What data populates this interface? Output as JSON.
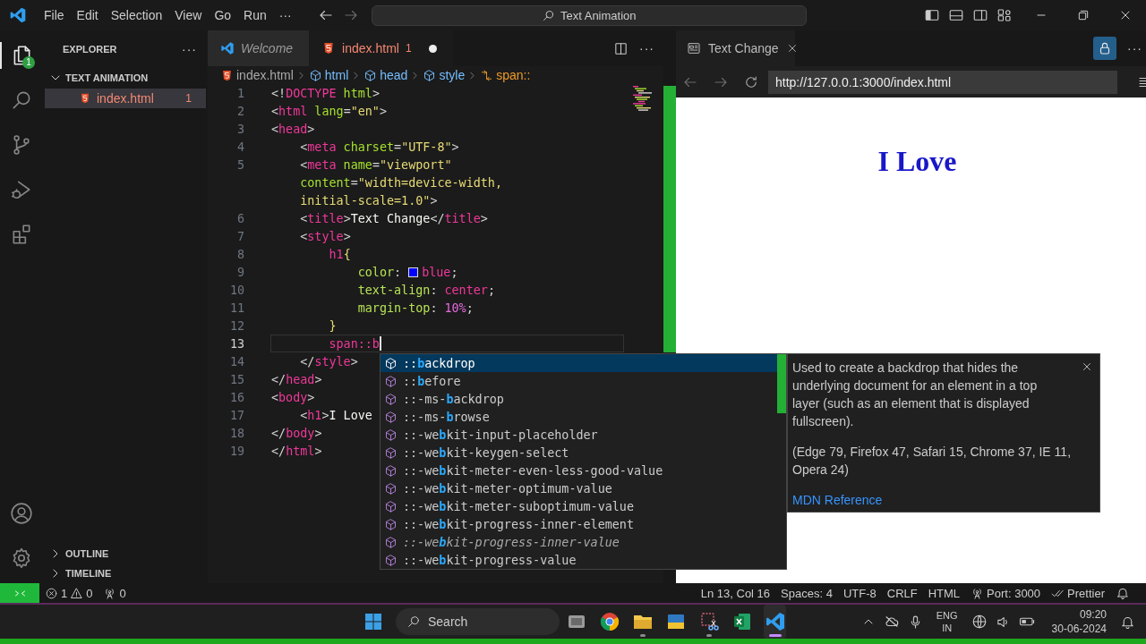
{
  "title_bar": {
    "menu": [
      "File",
      "Edit",
      "Selection",
      "View",
      "Go",
      "Run"
    ],
    "more": "···",
    "command_center": "Text Animation",
    "layout_toggles": [
      {
        "kind": "primary_sidebar",
        "on": true
      },
      {
        "kind": "panel",
        "on": false
      },
      {
        "kind": "secondary_sidebar",
        "on": false
      },
      {
        "kind": "customize",
        "on": false
      }
    ]
  },
  "activity_bar": {
    "items": [
      {
        "kind": "explorer",
        "selected": true,
        "badge": "1"
      },
      {
        "kind": "search",
        "selected": false
      },
      {
        "kind": "source_control",
        "selected": false
      },
      {
        "kind": "run_debug",
        "selected": false
      },
      {
        "kind": "extensions",
        "selected": false
      }
    ],
    "bottom": [
      {
        "kind": "accounts"
      },
      {
        "kind": "manage"
      }
    ]
  },
  "sidebar": {
    "title": "EXPLORER",
    "more": "···",
    "folder": {
      "title": "TEXT ANIMATION",
      "expanded": true,
      "files": [
        {
          "name": "index.html",
          "problems": "1",
          "selected": true
        }
      ]
    },
    "panels": [
      {
        "title": "OUTLINE",
        "expanded": false
      },
      {
        "title": "TIMELINE",
        "expanded": false
      }
    ]
  },
  "editor": {
    "tabs": [
      {
        "kind": "welcome",
        "label": "Welcome",
        "selected": false,
        "modified": false
      },
      {
        "kind": "html",
        "label": "index.html",
        "problems": "1",
        "selected": true,
        "modified": true
      }
    ],
    "more": "···",
    "breadcrumbs": [
      {
        "kind": "file",
        "label": "index.html"
      },
      {
        "kind": "element",
        "label": "html"
      },
      {
        "kind": "element",
        "label": "head"
      },
      {
        "kind": "element",
        "label": "style"
      },
      {
        "kind": "selector",
        "label": "span::"
      }
    ],
    "rows": [
      {
        "number": "1",
        "current": false,
        "tokens": [
          {
            "text": "<!",
            "kind": "p"
          },
          {
            "text": "DOCTYPE",
            "kind": "tag"
          },
          {
            "text": " html",
            "kind": "attr"
          },
          {
            "text": ">",
            "kind": "p"
          }
        ]
      },
      {
        "number": "2",
        "current": false,
        "tokens": [
          {
            "text": "<",
            "kind": "p"
          },
          {
            "text": "html",
            "kind": "tag"
          },
          {
            "text": " lang",
            "kind": "attr"
          },
          {
            "text": "=",
            "kind": "p"
          },
          {
            "text": "\"en\"",
            "kind": "str"
          },
          {
            "text": ">",
            "kind": "p"
          }
        ]
      },
      {
        "number": "3",
        "current": false,
        "tokens": [
          {
            "text": "<",
            "kind": "p"
          },
          {
            "text": "head",
            "kind": "tag"
          },
          {
            "text": ">",
            "kind": "p"
          }
        ]
      },
      {
        "number": "4",
        "current": false,
        "tokens": [
          {
            "text": "    <",
            "kind": "p"
          },
          {
            "text": "meta",
            "kind": "tag"
          },
          {
            "text": " charset",
            "kind": "attr"
          },
          {
            "text": "=",
            "kind": "p"
          },
          {
            "text": "\"UTF-8\"",
            "kind": "str"
          },
          {
            "text": ">",
            "kind": "p"
          }
        ]
      },
      {
        "number": "5",
        "current": false,
        "tokens": [
          {
            "text": "    <",
            "kind": "p"
          },
          {
            "text": "meta",
            "kind": "tag"
          },
          {
            "text": " name",
            "kind": "attr"
          },
          {
            "text": "=",
            "kind": "p"
          },
          {
            "text": "\"viewport\"",
            "kind": "str"
          }
        ]
      },
      {
        "current": false,
        "tokens": [
          {
            "text": "    content",
            "kind": "attr"
          },
          {
            "text": "=",
            "kind": "p"
          },
          {
            "text": "\"width=device-width,",
            "kind": "str"
          }
        ]
      },
      {
        "current": false,
        "tokens": [
          {
            "text": "    initial-scale=1.0\"",
            "kind": "str"
          },
          {
            "text": ">",
            "kind": "p"
          }
        ]
      },
      {
        "number": "6",
        "current": false,
        "tokens": [
          {
            "text": "    <",
            "kind": "p"
          },
          {
            "text": "title",
            "kind": "tag"
          },
          {
            "text": ">",
            "kind": "p"
          },
          {
            "text": "Text Change",
            "kind": "text"
          },
          {
            "text": "</",
            "kind": "p"
          },
          {
            "text": "title",
            "kind": "tag"
          },
          {
            "text": ">",
            "kind": "p"
          }
        ]
      },
      {
        "number": "7",
        "current": false,
        "tokens": [
          {
            "text": "    <",
            "kind": "p"
          },
          {
            "text": "style",
            "kind": "tag"
          },
          {
            "text": ">",
            "kind": "p"
          }
        ]
      },
      {
        "number": "8",
        "current": false,
        "tokens": [
          {
            "text": "        h1",
            "kind": "sel"
          },
          {
            "text": "{",
            "kind": "brace"
          }
        ]
      },
      {
        "number": "9",
        "current": false,
        "tokens": [
          {
            "text": "            color",
            "kind": "prop"
          },
          {
            "text": ": ",
            "kind": "p"
          },
          {
            "kind": "swatch",
            "color": "#0000ff"
          },
          {
            "text": "blue",
            "kind": "val"
          },
          {
            "text": ";",
            "kind": "p"
          }
        ]
      },
      {
        "number": "10",
        "current": false,
        "tokens": [
          {
            "text": "            text-align",
            "kind": "prop"
          },
          {
            "text": ": ",
            "kind": "p"
          },
          {
            "text": "center",
            "kind": "val"
          },
          {
            "text": ";",
            "kind": "p"
          }
        ]
      },
      {
        "number": "11",
        "current": false,
        "tokens": [
          {
            "text": "            margin-top",
            "kind": "prop"
          },
          {
            "text": ": ",
            "kind": "p"
          },
          {
            "text": "10%",
            "kind": "num"
          },
          {
            "text": ";",
            "kind": "p"
          }
        ]
      },
      {
        "number": "12",
        "current": false,
        "tokens": [
          {
            "text": "        }",
            "kind": "brace"
          }
        ]
      },
      {
        "number": "13",
        "current": true,
        "tokens": [
          {
            "text": "        span::b",
            "kind": "sel"
          }
        ]
      },
      {
        "number": "14",
        "current": false,
        "tokens": [
          {
            "text": "    </",
            "kind": "p"
          },
          {
            "text": "style",
            "kind": "tag"
          },
          {
            "text": ">",
            "kind": "p"
          }
        ]
      },
      {
        "number": "15",
        "current": false,
        "tokens": [
          {
            "text": "</",
            "kind": "p"
          },
          {
            "text": "head",
            "kind": "tag"
          },
          {
            "text": ">",
            "kind": "p"
          }
        ]
      },
      {
        "number": "16",
        "current": false,
        "tokens": [
          {
            "text": "<",
            "kind": "p"
          },
          {
            "text": "body",
            "kind": "tag"
          },
          {
            "text": ">",
            "kind": "p"
          }
        ]
      },
      {
        "number": "17",
        "current": false,
        "tokens": [
          {
            "text": "    <",
            "kind": "p"
          },
          {
            "text": "h1",
            "kind": "tag"
          },
          {
            "text": ">",
            "kind": "p"
          },
          {
            "text": "I Love",
            "kind": "text"
          }
        ]
      },
      {
        "number": "18",
        "current": false,
        "tokens": [
          {
            "text": "</",
            "kind": "p"
          },
          {
            "text": "body",
            "kind": "tag"
          },
          {
            "text": ">",
            "kind": "p"
          }
        ]
      },
      {
        "number": "19",
        "current": false,
        "tokens": [
          {
            "text": "</",
            "kind": "p"
          },
          {
            "text": "html",
            "kind": "tag"
          },
          {
            "text": ">",
            "kind": "p"
          }
        ]
      }
    ]
  },
  "suggest": {
    "items": [
      {
        "before": "::",
        "match": "b",
        "after": "ackdrop",
        "selected": true,
        "deprecated": false
      },
      {
        "before": "::",
        "match": "b",
        "after": "efore",
        "selected": false,
        "deprecated": false
      },
      {
        "before": "::-ms-",
        "match": "b",
        "after": "ackdrop",
        "selected": false,
        "deprecated": false
      },
      {
        "before": "::-ms-",
        "match": "b",
        "after": "rowse",
        "selected": false,
        "deprecated": false
      },
      {
        "before": "::-we",
        "match": "b",
        "after": "kit-input-placeholder",
        "selected": false,
        "deprecated": false
      },
      {
        "before": "::-we",
        "match": "b",
        "after": "kit-keygen-select",
        "selected": false,
        "deprecated": false
      },
      {
        "before": "::-we",
        "match": "b",
        "after": "kit-meter-even-less-good-value",
        "selected": false,
        "deprecated": false
      },
      {
        "before": "::-we",
        "match": "b",
        "after": "kit-meter-optimum-value",
        "selected": false,
        "deprecated": false
      },
      {
        "before": "::-we",
        "match": "b",
        "after": "kit-meter-suboptimum-value",
        "selected": false,
        "deprecated": false
      },
      {
        "before": "::-we",
        "match": "b",
        "after": "kit-progress-inner-element",
        "selected": false,
        "deprecated": false
      },
      {
        "before": "::-we",
        "match": "b",
        "after": "kit-progress-inner-value",
        "selected": false,
        "deprecated": true
      },
      {
        "before": "::-we",
        "match": "b",
        "after": "kit-progress-value",
        "selected": false,
        "deprecated": false
      }
    ]
  },
  "details": {
    "description_lines": [
      "Used to create a backdrop that hides the",
      "underlying document for an element in a top",
      "layer (such as an element that is displayed",
      "fullscreen)."
    ],
    "support_lines": [
      "(Edge 79, Firefox 47, Safari 15, Chrome 37, IE 11,",
      "Opera 24)"
    ],
    "link": "MDN Reference"
  },
  "browser": {
    "tab": {
      "label": "Text Change"
    },
    "more": "···",
    "url": "http://127.0.0.1:3000/index.html",
    "page": {
      "heading": "I Love"
    }
  },
  "status_bar": {
    "left": [
      {
        "kind": "remote"
      },
      {
        "kind": "problems",
        "errors": "1",
        "warnings": "0"
      },
      {
        "kind": "ports",
        "text": "0"
      }
    ],
    "right": [
      {
        "kind": "text",
        "text": "Ln 13, Col 16"
      },
      {
        "kind": "text",
        "text": "Spaces: 4"
      },
      {
        "kind": "text",
        "text": "UTF-8"
      },
      {
        "kind": "text",
        "text": "CRLF"
      },
      {
        "kind": "text",
        "text": "HTML"
      },
      {
        "kind": "port",
        "text": "Port: 3000"
      },
      {
        "kind": "formatter",
        "text": "Prettier"
      },
      {
        "kind": "notifications"
      }
    ]
  },
  "taskbar": {
    "search": {
      "placeholder": "Search"
    },
    "apps": [
      {
        "kind": "task_view",
        "running": false,
        "selected": false
      },
      {
        "kind": "browser",
        "running": false,
        "selected": false
      },
      {
        "kind": "files",
        "running": true,
        "selected": false
      },
      {
        "kind": "gallery",
        "running": false,
        "selected": false
      },
      {
        "kind": "snipping",
        "running": true,
        "selected": false
      },
      {
        "kind": "spreadsheet",
        "running": false,
        "selected": false
      },
      {
        "kind": "code",
        "running": true,
        "selected": true
      }
    ],
    "tray": {
      "language": "ENG",
      "region": "IN",
      "time": "09:20",
      "date": "30-06-2024"
    }
  }
}
